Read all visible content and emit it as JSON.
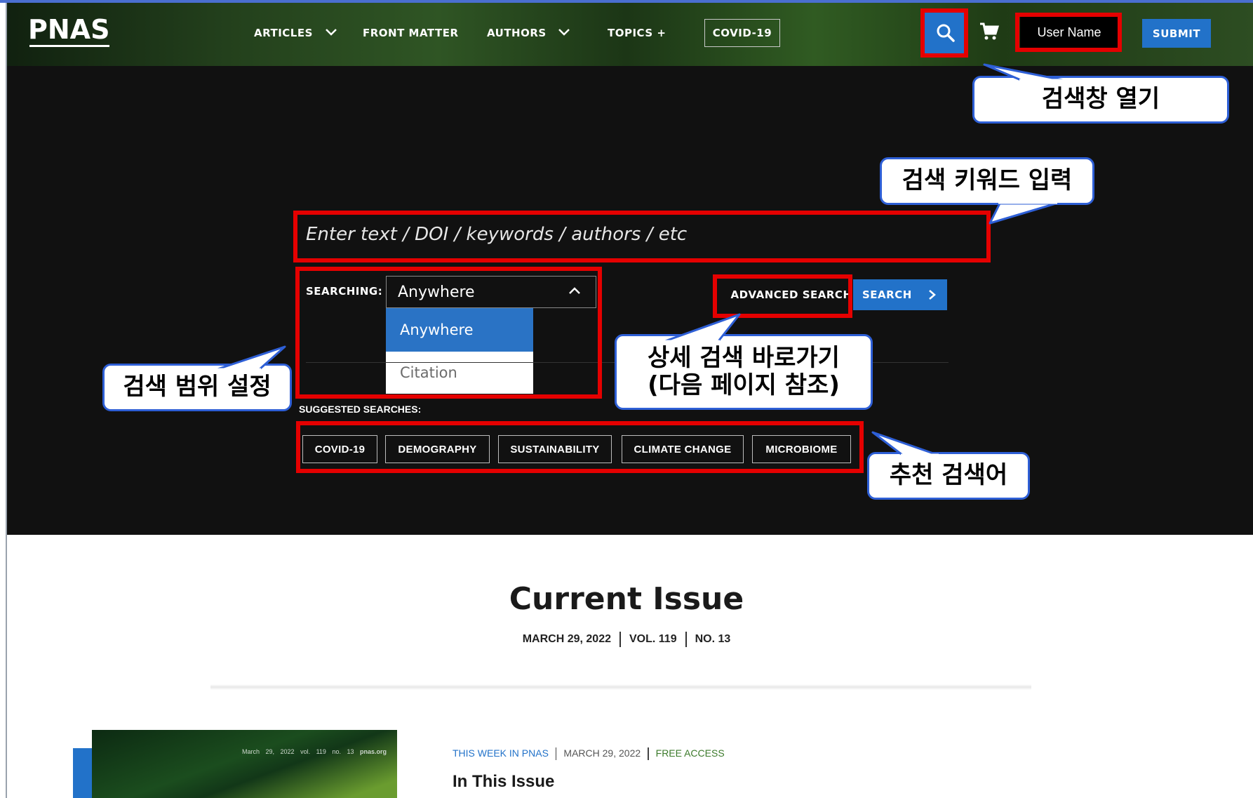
{
  "header": {
    "logo": "PNAS",
    "nav": {
      "articles": "ARTICLES",
      "front_matter": "FRONT MATTER",
      "authors": "AUTHORS",
      "topics": "TOPICS +",
      "covid": "COVID-19"
    },
    "user_name": "User Name",
    "submit": "SUBMIT"
  },
  "search_panel": {
    "placeholder": "Enter text / DOI / keywords / authors / etc",
    "searching_label": "SEARCHING:",
    "scope_selected": "Anywhere",
    "scope_options": [
      "Anywhere",
      "Citation"
    ],
    "advanced_search": "ADVANCED SEARCH",
    "search_button": "SEARCH",
    "suggested_label": "SUGGESTED SEARCHES:",
    "suggested": [
      "COVID-19",
      "DEMOGRAPHY",
      "SUSTAINABILITY",
      "CLIMATE CHANGE",
      "MICROBIOME"
    ]
  },
  "annotations": {
    "open_search": "검색창 열기",
    "keyword_input": "검색 키워드 입력",
    "scope_setting": "검색 범위 설정",
    "advanced_line1": "상세 검색 바로가기",
    "advanced_line2": "(다음 페이지 참조)",
    "suggested": "추천 검색어",
    "box_color": "#e50000",
    "callout_border": "#2e5fd6"
  },
  "current_issue": {
    "title": "Current Issue",
    "date": "MARCH 29, 2022",
    "volume": "VOL. 119",
    "number": "NO. 13",
    "cover_date": "March 29, 2022",
    "cover_vol": "vol. 119",
    "cover_no": "no. 13",
    "cover_site": "pnas.org"
  },
  "article": {
    "section": "THIS WEEK IN PNAS",
    "date": "MARCH 29, 2022",
    "access": "FREE ACCESS",
    "title": "In This Issue",
    "section_color": "#2272c9",
    "access_color": "#3b7a2a"
  },
  "colors": {
    "accent": "#2272c9",
    "panel_bg": "#111111"
  }
}
